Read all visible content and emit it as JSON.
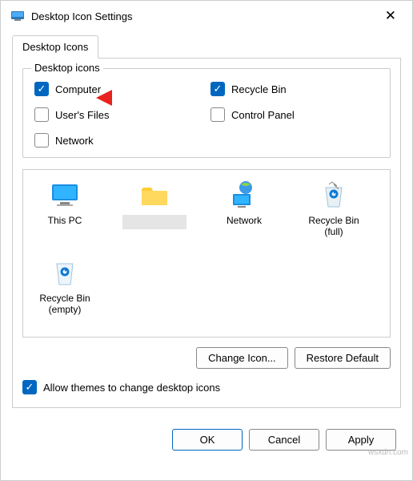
{
  "window": {
    "title": "Desktop Icon Settings"
  },
  "tabs": {
    "active": "Desktop Icons"
  },
  "group": {
    "label": "Desktop icons",
    "checkboxes": {
      "computer": {
        "label": "Computer",
        "checked": true
      },
      "recycle_bin": {
        "label": "Recycle Bin",
        "checked": true
      },
      "users_files": {
        "label": "User's Files",
        "checked": false
      },
      "control_panel": {
        "label": "Control Panel",
        "checked": false
      },
      "network": {
        "label": "Network",
        "checked": false
      }
    }
  },
  "icons": [
    {
      "name": "this-pc",
      "label": "This PC",
      "type": "monitor"
    },
    {
      "name": "folder",
      "label": "",
      "type": "folder",
      "redacted": true
    },
    {
      "name": "network",
      "label": "Network",
      "type": "network"
    },
    {
      "name": "recycle-full",
      "label": "Recycle Bin (full)",
      "type": "recycle-full"
    },
    {
      "name": "recycle-empty",
      "label": "Recycle Bin (empty)",
      "type": "recycle-empty"
    }
  ],
  "buttons": {
    "change_icon": "Change Icon...",
    "restore_default": "Restore Default",
    "ok": "OK",
    "cancel": "Cancel",
    "apply": "Apply"
  },
  "allow_themes": {
    "label": "Allow themes to change desktop icons",
    "checked": true
  },
  "watermark": "wsxdn.com"
}
